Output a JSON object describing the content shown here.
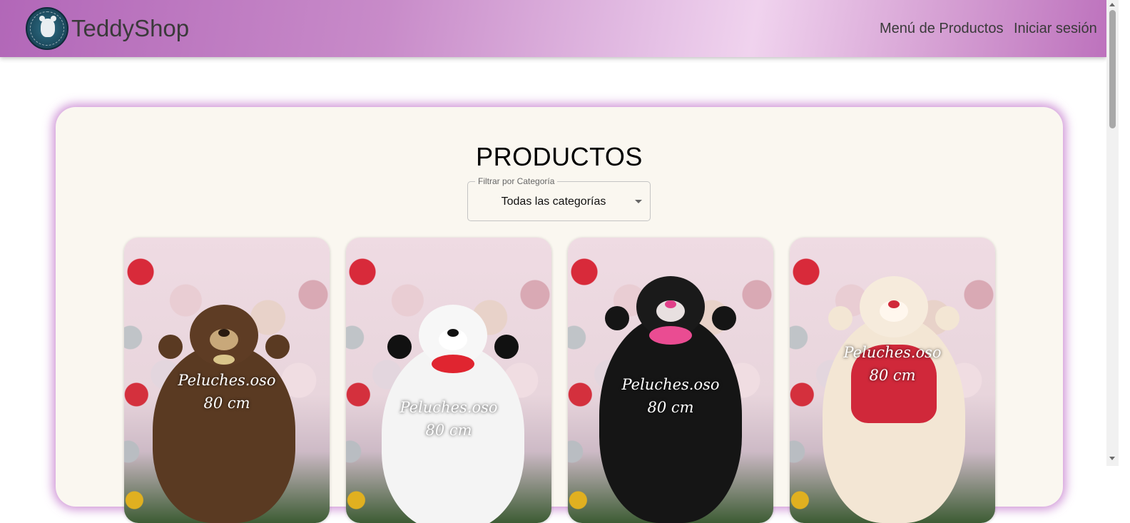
{
  "navbar": {
    "brand": "TeddyShop",
    "links": [
      {
        "label": "Menú de Productos"
      },
      {
        "label": "Iniciar sesión"
      }
    ]
  },
  "main": {
    "title": "PRODUCTOS",
    "filter": {
      "label": "Filtrar por Categoría",
      "value": "Todas las categorías"
    },
    "products": [
      {
        "image_text": "Peluches.oso",
        "size_text": "80 cm",
        "bear_color": "#5a3a22"
      },
      {
        "image_text": "Peluches.oso",
        "size_text": "80 cm",
        "bear_color": "#f4f4f4"
      },
      {
        "image_text": "Peluches.oso",
        "size_text": "80 cm",
        "bear_color": "#151515"
      },
      {
        "image_text": "Peluches.oso",
        "size_text": "80 cm",
        "bear_color": "#f3e6d4"
      }
    ]
  },
  "colors": {
    "navbar_gradient_start": "#b267b8",
    "navbar_gradient_highlight": "#f0d3ee",
    "panel_background": "#faf7f0",
    "panel_glow": "#be6ec8"
  }
}
